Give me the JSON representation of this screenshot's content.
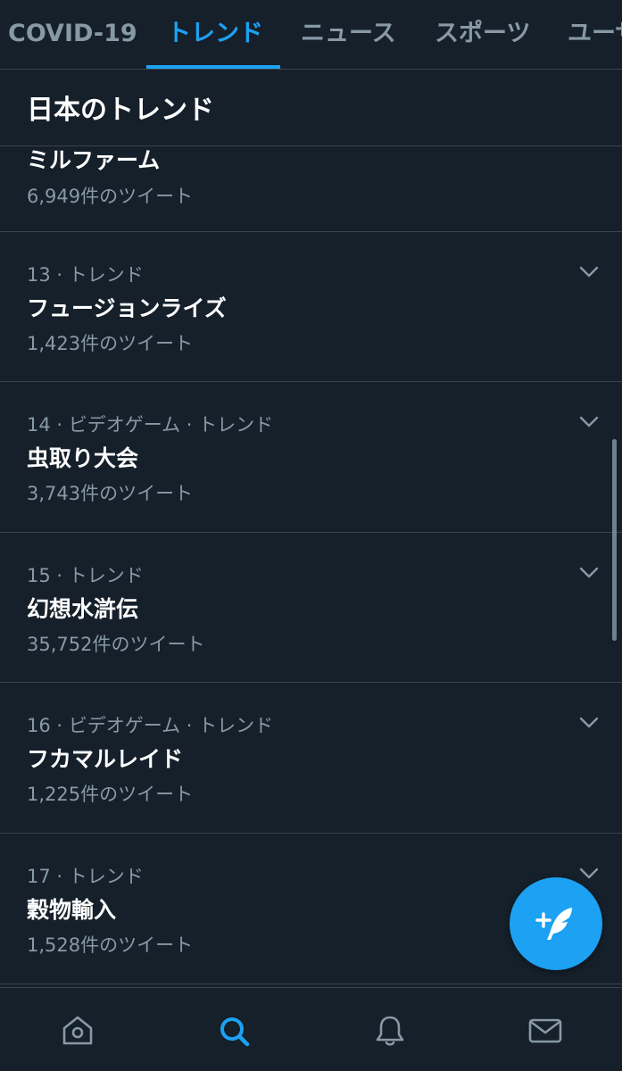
{
  "tabs": [
    {
      "label": "COVID-19",
      "active": false
    },
    {
      "label": "トレンド",
      "active": true
    },
    {
      "label": "ニュース",
      "active": false
    },
    {
      "label": "スポーツ",
      "active": false
    },
    {
      "label": "ユーザー",
      "active": false
    }
  ],
  "section_title": "日本のトレンド",
  "trends": [
    {
      "meta": "",
      "name": "ミルファーム",
      "count": "6,949件のツイート"
    },
    {
      "meta": "13 · トレンド",
      "name": "フュージョンライズ",
      "count": "1,423件のツイート"
    },
    {
      "meta": "14 · ビデオゲーム · トレンド",
      "name": "虫取り大会",
      "count": "3,743件のツイート"
    },
    {
      "meta": "15 · トレンド",
      "name": "幻想水滸伝",
      "count": "35,752件のツイート"
    },
    {
      "meta": "16 · ビデオゲーム · トレンド",
      "name": "フカマルレイド",
      "count": "1,225件のツイート"
    },
    {
      "meta": "17 · トレンド",
      "name": "穀物輸入",
      "count": "1,528件のツイート"
    }
  ],
  "icons": {
    "chevron": "chevron-down-icon",
    "compose": "compose-tweet-icon",
    "nav": [
      "home-icon",
      "search-icon",
      "bell-icon",
      "mail-icon"
    ]
  },
  "colors": {
    "background": "#15202b",
    "accent": "#1da1f2",
    "secondary_text": "#8899a6",
    "divider": "#38444d"
  }
}
